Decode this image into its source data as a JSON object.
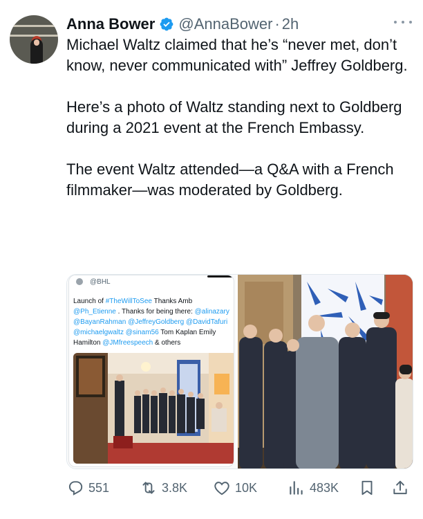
{
  "author": {
    "name": "Anna Bower",
    "handle": "@AnnaBower",
    "separator": "·",
    "time": "2h",
    "verified_icon": "verified-badge-icon",
    "accent": "#1d9bf0"
  },
  "tweet": {
    "paragraphs": [
      "Michael Waltz claimed that he’s “never met, don’t know, never communicated with” Jeffrey Goldberg.",
      "Here’s a photo of Waltz standing next to Goldberg during a 2021 event at the French Embassy.",
      "The event Waltz attended—a Q&A with a French filmmaker—was moderated by Goldberg."
    ]
  },
  "embedded": {
    "handle": "@BHL",
    "text_parts": [
      {
        "t": "Launch of ",
        "link": false
      },
      {
        "t": "#TheWillToSee",
        "link": true
      },
      {
        "t": " Thanks Amb ",
        "link": false
      },
      {
        "t": "@Ph_Etienne",
        "link": true
      },
      {
        "t": " . Thanks for being there: ",
        "link": false
      },
      {
        "t": "@alinazary",
        "link": true
      },
      {
        "t": " ",
        "link": false
      },
      {
        "t": "@BayanRahman",
        "link": true
      },
      {
        "t": " ",
        "link": false
      },
      {
        "t": "@JeffreyGoldberg",
        "link": true
      },
      {
        "t": " ",
        "link": false
      },
      {
        "t": "@DavidTafuri",
        "link": true
      },
      {
        "t": " ",
        "link": false
      },
      {
        "t": "@michaelgwaltz",
        "link": true
      },
      {
        "t": " ",
        "link": false
      },
      {
        "t": "@sinam56",
        "link": true
      },
      {
        "t": " Tom Kaplan Emily Hamilton ",
        "link": false
      },
      {
        "t": "@JMfreespeech",
        "link": true
      },
      {
        "t": " & others",
        "link": false
      }
    ]
  },
  "actions": {
    "replies": "551",
    "reposts": "3.8K",
    "likes": "10K",
    "views": "483K",
    "icons": [
      "reply-icon",
      "repost-icon",
      "like-icon",
      "views-icon",
      "bookmark-icon",
      "share-icon"
    ]
  }
}
